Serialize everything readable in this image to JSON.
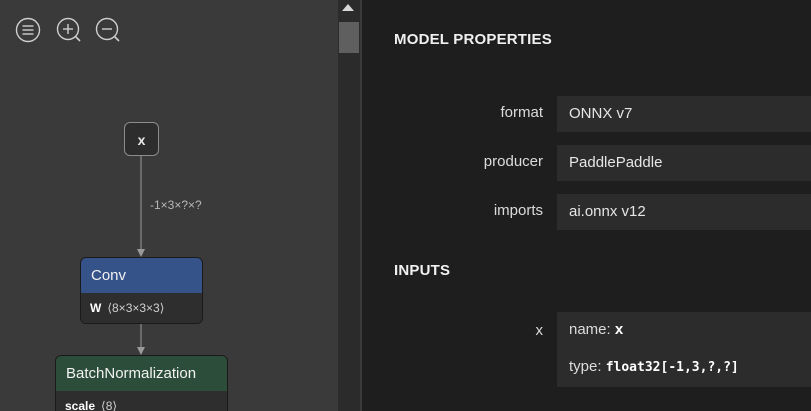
{
  "toolbar": {
    "sidebar_icon": "menu-icon",
    "zoom_in_icon": "zoom-in-icon",
    "zoom_out_icon": "zoom-out-icon"
  },
  "graph": {
    "input_node": {
      "label": "x"
    },
    "edge_label": "-1×3×?×?",
    "nodes": [
      {
        "type": "Conv",
        "color": "#355289",
        "attr_name": "W",
        "attr_value": "⟨8×3×3×3⟩"
      },
      {
        "type": "BatchNormalization",
        "color": "#2c4d3a",
        "attr_name": "scale",
        "attr_value": "⟨8⟩"
      }
    ]
  },
  "properties": {
    "title": "MODEL PROPERTIES",
    "rows": [
      {
        "label": "format",
        "value": "ONNX v7"
      },
      {
        "label": "producer",
        "value": "PaddlePaddle"
      },
      {
        "label": "imports",
        "value": "ai.onnx v12"
      }
    ],
    "inputs_title": "INPUTS",
    "inputs": [
      {
        "label": "x",
        "name_key": "name:",
        "name_value": "x",
        "type_key": "type:",
        "type_value": "float32[-1,3,?,?]"
      }
    ]
  }
}
